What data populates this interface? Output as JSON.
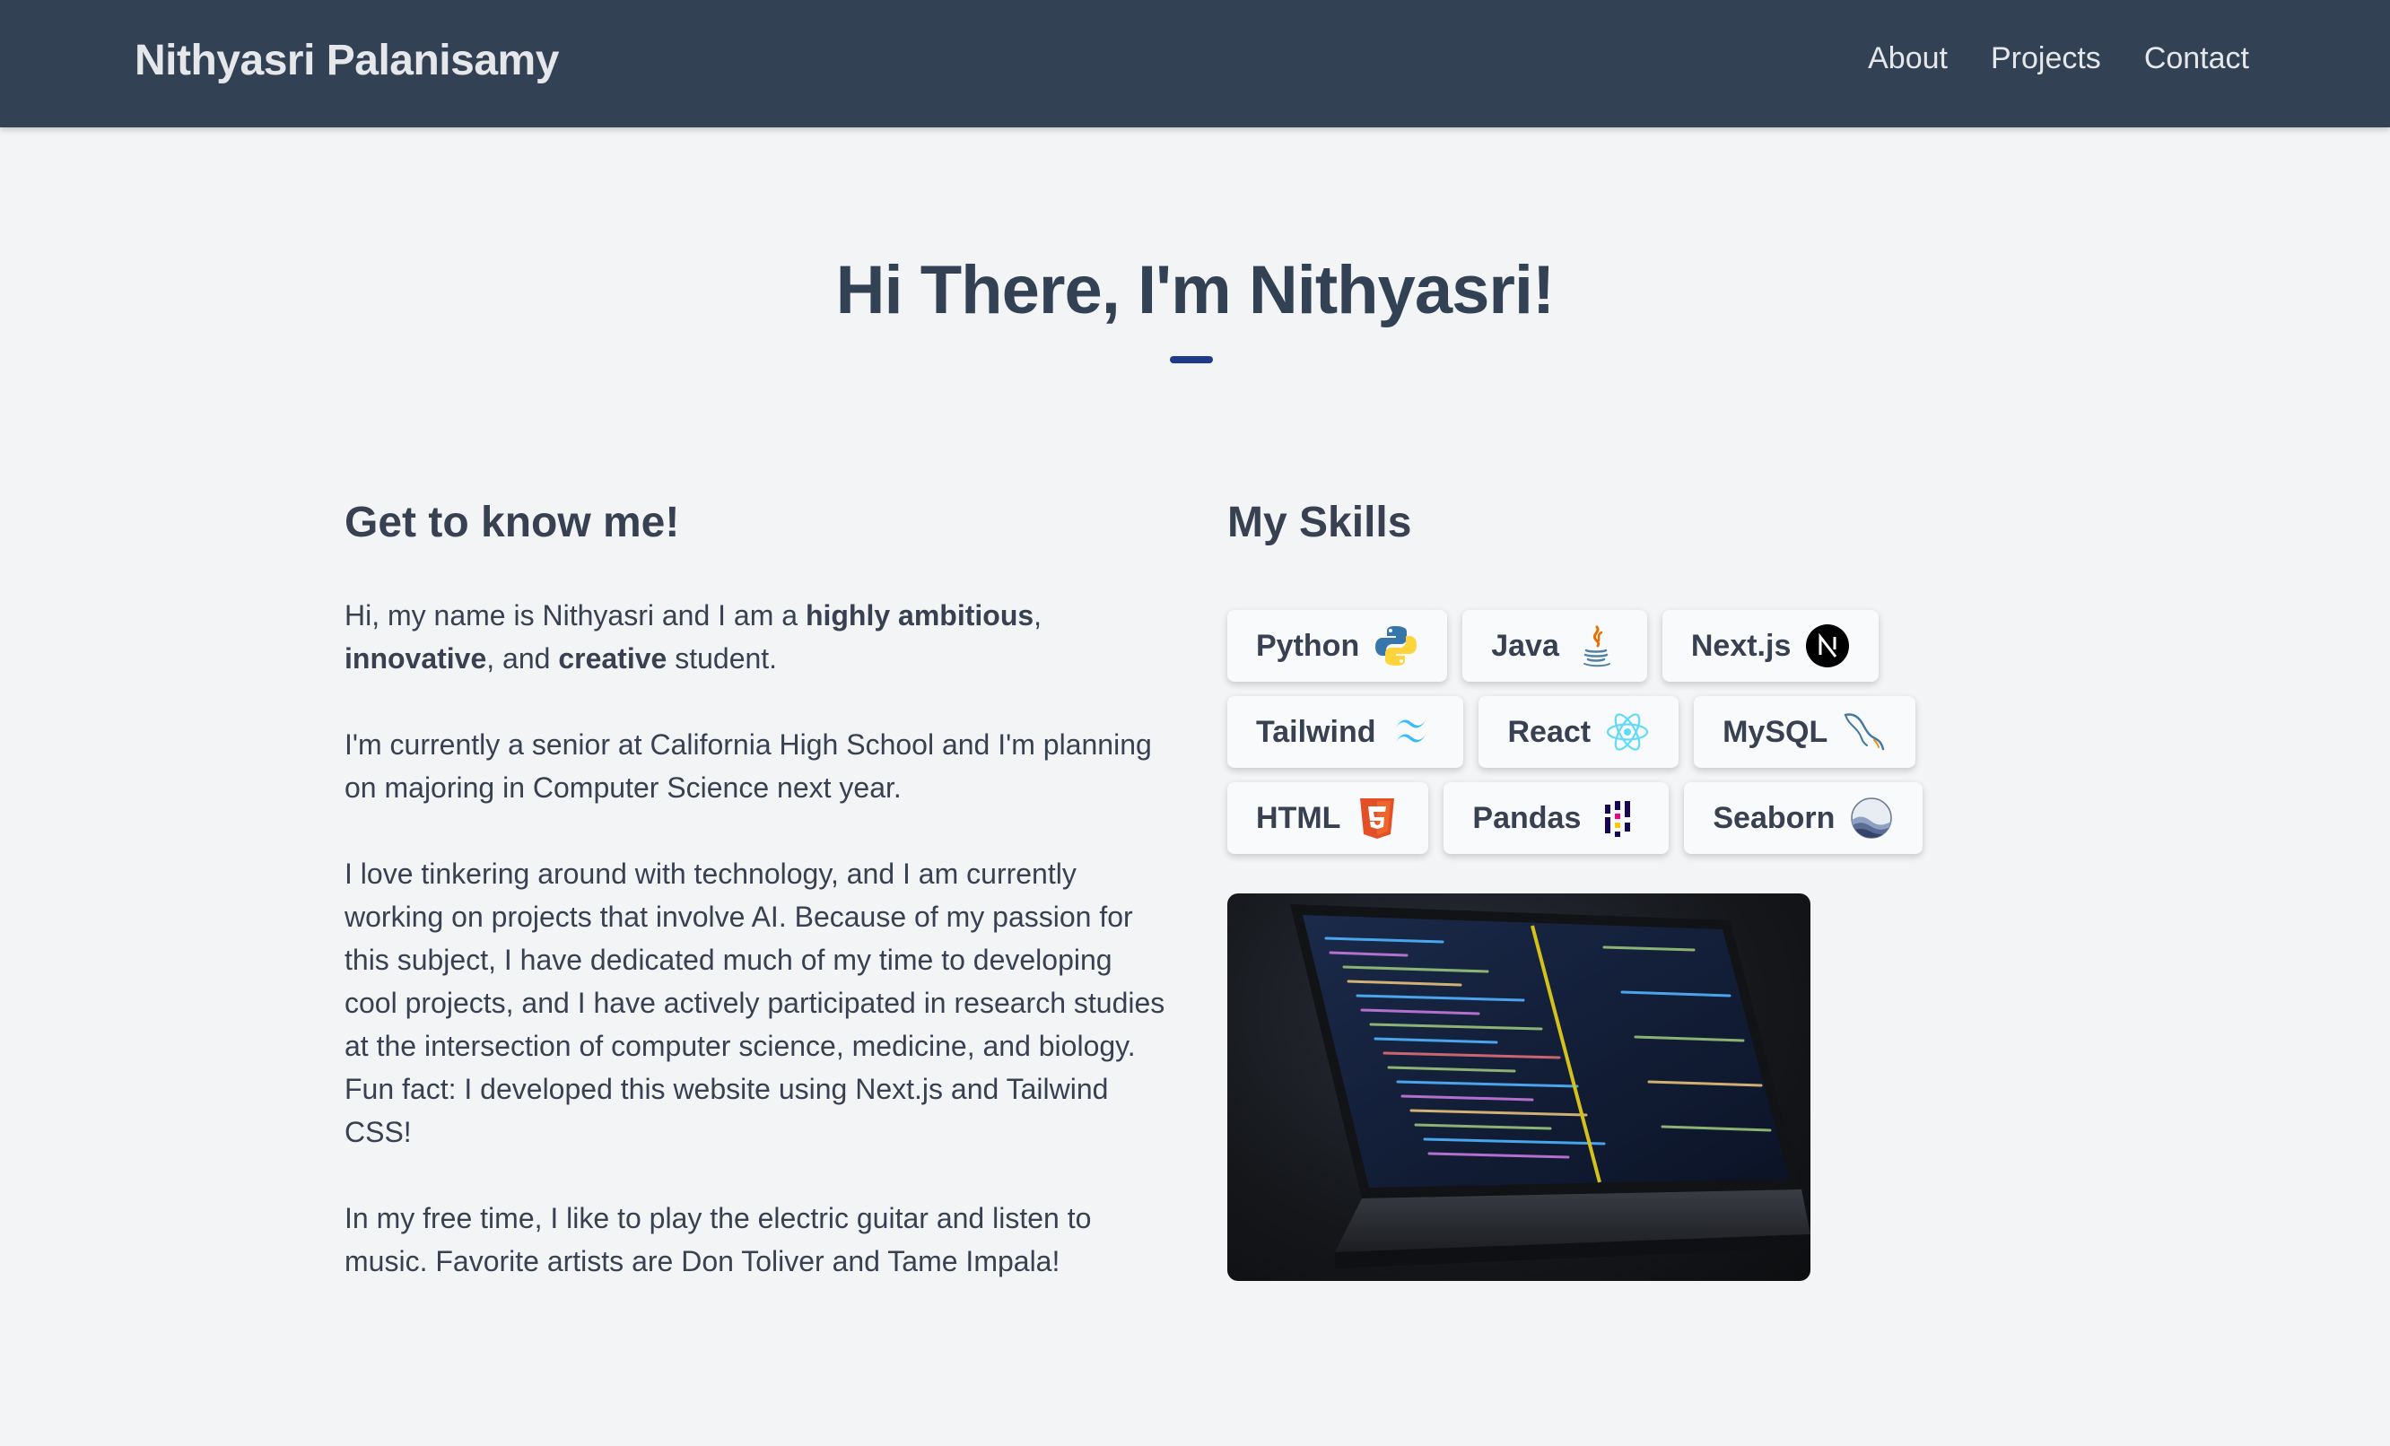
{
  "header": {
    "brand": "Nithyasri Palanisamy",
    "nav": [
      {
        "label": "About"
      },
      {
        "label": "Projects"
      },
      {
        "label": "Contact"
      }
    ]
  },
  "hero": {
    "title": "Hi There, I'm Nithyasri!",
    "accent_color": "#1e3a8a"
  },
  "about": {
    "heading": "Get to know me!",
    "p1": {
      "a": "Hi, my name is Nithyasri and I am a ",
      "b1": "highly ambitious",
      "c": ", ",
      "b2": "innovative",
      "d": ", and ",
      "b3": "creative",
      "e": " student."
    },
    "p2": "I'm currently a senior at California High School and I'm planning on majoring in Computer Science next year.",
    "p3": "I love tinkering around with technology, and I am currently working on projects that involve AI. Because of my passion for this subject, I have dedicated much of my time to developing cool projects, and I have actively participated in research studies at the intersection of computer science, medicine, and biology. Fun fact: I developed this website using Next.js and Tailwind CSS!",
    "p4": "In my free time, I like to play the electric guitar and listen to music. Favorite artists are Don Toliver and Tame Impala!"
  },
  "skills": {
    "heading": "My Skills",
    "rows": [
      [
        {
          "label": "Python",
          "icon": "python-icon"
        },
        {
          "label": "Java",
          "icon": "java-icon"
        },
        {
          "label": "Next.js",
          "icon": "nextjs-icon"
        }
      ],
      [
        {
          "label": "Tailwind",
          "icon": "tailwind-icon"
        },
        {
          "label": "React",
          "icon": "react-icon"
        },
        {
          "label": "MySQL",
          "icon": "mysql-icon"
        }
      ],
      [
        {
          "label": "HTML",
          "icon": "html5-icon"
        },
        {
          "label": "Pandas",
          "icon": "pandas-icon"
        },
        {
          "label": "Seaborn",
          "icon": "seaborn-icon"
        }
      ]
    ]
  },
  "image": {
    "subject": "laptop-with-code-editor"
  },
  "colors": {
    "navbar": "#334155",
    "background": "#f3f4f6",
    "text": "#374151"
  }
}
